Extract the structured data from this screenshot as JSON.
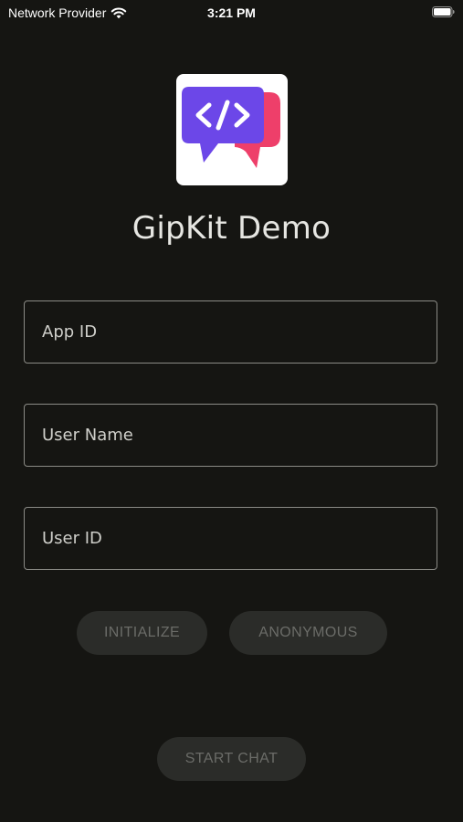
{
  "status_bar": {
    "carrier": "Network Provider",
    "time": "3:21 PM"
  },
  "app": {
    "icon": "code-chat-bubble-icon",
    "title": "GipKit Demo"
  },
  "form": {
    "app_id_placeholder": "App ID",
    "user_name_placeholder": "User Name",
    "user_id_placeholder": "User ID"
  },
  "buttons": {
    "initialize": "INITIALIZE",
    "anonymous": "ANONYMOUS",
    "start_chat": "START CHAT"
  },
  "colors": {
    "background": "#151512",
    "button_bg": "#2b2c29",
    "button_text": "#6b6c68",
    "icon_purple": "#6c47e8",
    "icon_pink": "#ee3f6a"
  }
}
